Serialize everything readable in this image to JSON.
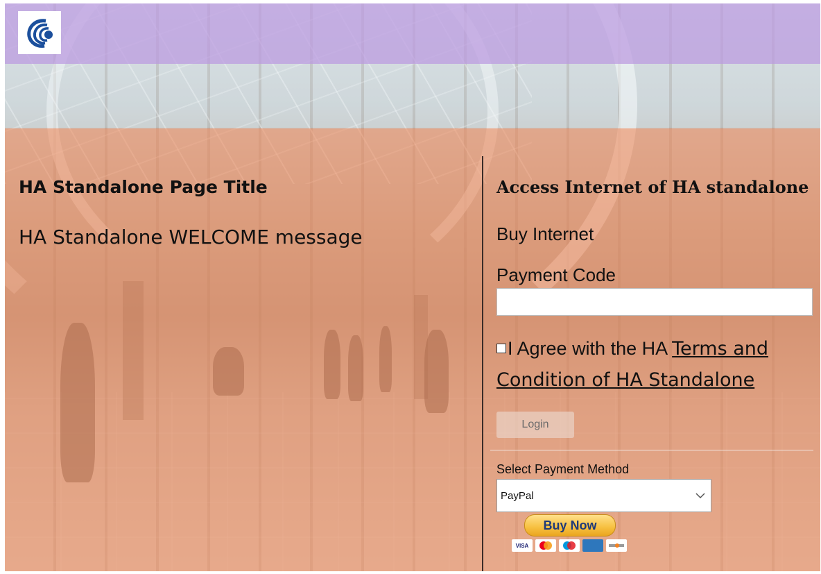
{
  "header": {
    "logo_icon": "cambium-swirl-logo-icon"
  },
  "left": {
    "title": "HA Standalone Page Title",
    "welcome": "HA Standalone WELCOME message"
  },
  "right": {
    "heading": "Access Internet of HA standalone",
    "buy_internet": "Buy Internet",
    "payment_code_label": "Payment Code",
    "payment_code_value": "",
    "agree_prefix": "I Agree with the HA ",
    "terms_link": "Terms and Condition of HA Standalone",
    "login_label": "Login",
    "select_payment_label": "Select Payment Method",
    "payment_method_selected": "PayPal",
    "buy_now_label": "Buy Now",
    "card_icons": [
      "VISA",
      "mastercard",
      "maestro",
      "amex",
      "discover"
    ]
  },
  "colors": {
    "top_overlay": "#bea0e1",
    "main_overlay": "#ee966e",
    "divider": "#3a2c28",
    "buy_now_gold": "#f7c040",
    "buy_now_text": "#1f3a7a"
  }
}
